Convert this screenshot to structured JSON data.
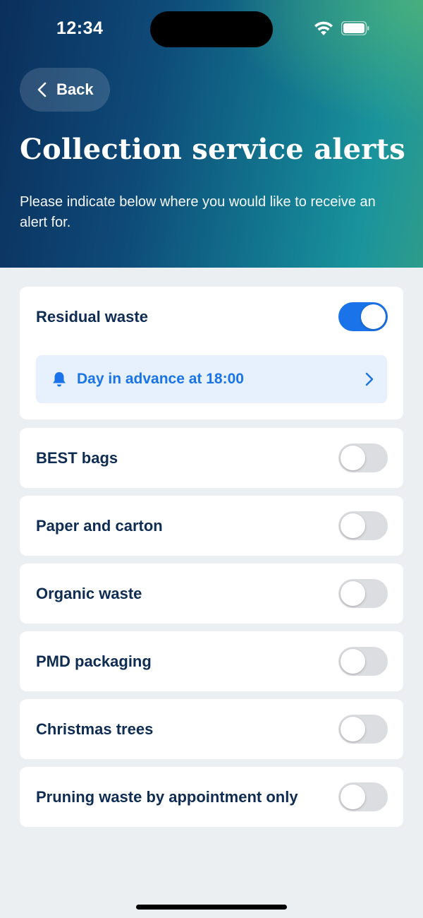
{
  "status_bar": {
    "time": "12:34"
  },
  "header": {
    "back_label": "Back",
    "title": "Collection service alerts",
    "subtitle": "Please indicate below where you would like to receive an alert for."
  },
  "alerts": [
    {
      "label": "Residual waste",
      "enabled": true,
      "reminder": "Day in advance at 18:00"
    },
    {
      "label": "BEST bags",
      "enabled": false
    },
    {
      "label": "Paper and carton",
      "enabled": false
    },
    {
      "label": "Organic waste",
      "enabled": false
    },
    {
      "label": "PMD packaging",
      "enabled": false
    },
    {
      "label": "Christmas trees",
      "enabled": false
    },
    {
      "label": "Pruning waste by appointment only",
      "enabled": false
    }
  ],
  "colors": {
    "accent": "#1A73E8",
    "text_primary": "#0F2D52",
    "background": "#ECEFF2",
    "toggle_off": "#DCDDE0"
  },
  "icons": [
    "back-chevron-icon",
    "bell-icon",
    "chevron-right-icon",
    "wifi-icon",
    "battery-icon"
  ]
}
